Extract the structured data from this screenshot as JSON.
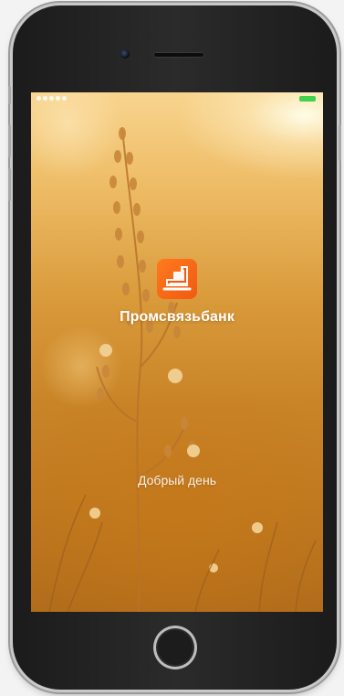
{
  "app": {
    "brand_name": "Промсвязьбанк",
    "greeting": "Добрый день"
  },
  "status_bar": {
    "battery_color": "#3fd24a"
  },
  "icons": {
    "logo": "psb-logo-icon",
    "home": "home-button-icon",
    "camera": "front-camera-icon"
  },
  "colors": {
    "brand_orange": "#f05a10",
    "text": "#ffffff"
  }
}
